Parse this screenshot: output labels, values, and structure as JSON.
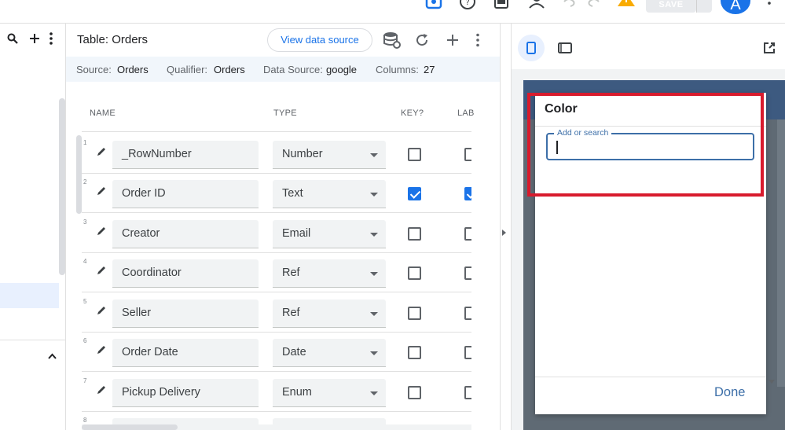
{
  "top_toolbar": {
    "save_label": "SAVE",
    "avatar_letter": "A"
  },
  "table": {
    "title": "Table: Orders",
    "view_data_source_label": "View data source",
    "info": {
      "source_label": "Source:",
      "source_value": "Orders",
      "qualifier_label": "Qualifier:",
      "qualifier_value": "Orders",
      "data_source_label": "Data Source:",
      "data_source_value": "google",
      "columns_label": "Columns:",
      "columns_value": "27"
    },
    "column_headers": {
      "name": "NAME",
      "type": "TYPE",
      "key": "KEY?",
      "label": "LAB"
    },
    "rows": [
      {
        "num": "1",
        "name": "_RowNumber",
        "type": "Number",
        "key": false,
        "label": false
      },
      {
        "num": "2",
        "name": "Order ID",
        "type": "Text",
        "key": true,
        "label": true
      },
      {
        "num": "3",
        "name": "Creator",
        "type": "Email",
        "key": false,
        "label": false
      },
      {
        "num": "4",
        "name": "Coordinator",
        "type": "Ref",
        "key": false,
        "label": false
      },
      {
        "num": "5",
        "name": "Seller",
        "type": "Ref",
        "key": false,
        "label": false
      },
      {
        "num": "6",
        "name": "Order Date",
        "type": "Date",
        "key": false,
        "label": false
      },
      {
        "num": "7",
        "name": "Pickup Delivery",
        "type": "Enum",
        "key": false,
        "label": false
      },
      {
        "num": "8",
        "name": "",
        "type": "",
        "key": false,
        "label": false
      }
    ]
  },
  "preview": {
    "dialog_title": "Color",
    "search_label": "Add or search",
    "search_value": "",
    "done_label": "Done"
  },
  "colors": {
    "accent": "#1a73e8",
    "highlight": "#d81b2d",
    "dialog_accent": "#3d6fa8"
  }
}
